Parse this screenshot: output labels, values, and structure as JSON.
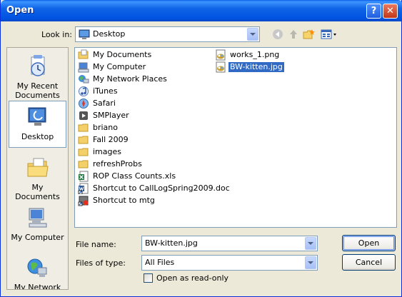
{
  "window": {
    "title": "Open",
    "help_label": "?",
    "close_label": "✕"
  },
  "lookin": {
    "label": "Look in:",
    "value": "Desktop"
  },
  "places": [
    {
      "label": "My Recent Documents",
      "icon": "recent-documents-icon"
    },
    {
      "label": "Desktop",
      "icon": "desktop-icon",
      "selected": true
    },
    {
      "label": "My Documents",
      "icon": "my-documents-icon"
    },
    {
      "label": "My Computer",
      "icon": "my-computer-icon"
    },
    {
      "label": "My Network",
      "icon": "my-network-icon"
    }
  ],
  "files_col1": [
    {
      "name": "My Documents",
      "icon": "folder-docs-icon"
    },
    {
      "name": "My Computer",
      "icon": "computer-icon"
    },
    {
      "name": "My Network Places",
      "icon": "network-icon"
    },
    {
      "name": "iTunes",
      "icon": "itunes-icon"
    },
    {
      "name": "Safari",
      "icon": "safari-icon"
    },
    {
      "name": "SMPlayer",
      "icon": "smplayer-icon"
    },
    {
      "name": "briano",
      "icon": "folder-icon"
    },
    {
      "name": "Fall 2009",
      "icon": "folder-icon"
    },
    {
      "name": "images",
      "icon": "folder-icon"
    },
    {
      "name": "refreshProbs",
      "icon": "folder-icon"
    },
    {
      "name": "ROP Class Counts.xls",
      "icon": "excel-icon"
    },
    {
      "name": "Shortcut to CallLogSpring2009.doc",
      "icon": "word-icon"
    },
    {
      "name": "Shortcut to mtg",
      "icon": "shortcut-icon"
    }
  ],
  "files_col2": [
    {
      "name": "works_1.png",
      "icon": "image-icon"
    },
    {
      "name": "BW-kitten.jpg",
      "icon": "image-icon",
      "selected": true
    }
  ],
  "filename": {
    "label": "File name:",
    "value": "BW-kitten.jpg"
  },
  "filetype": {
    "label": "Files of type:",
    "value": "All Files"
  },
  "readonly": {
    "label": "Open as read-only"
  },
  "buttons": {
    "open": "Open",
    "cancel": "Cancel"
  }
}
